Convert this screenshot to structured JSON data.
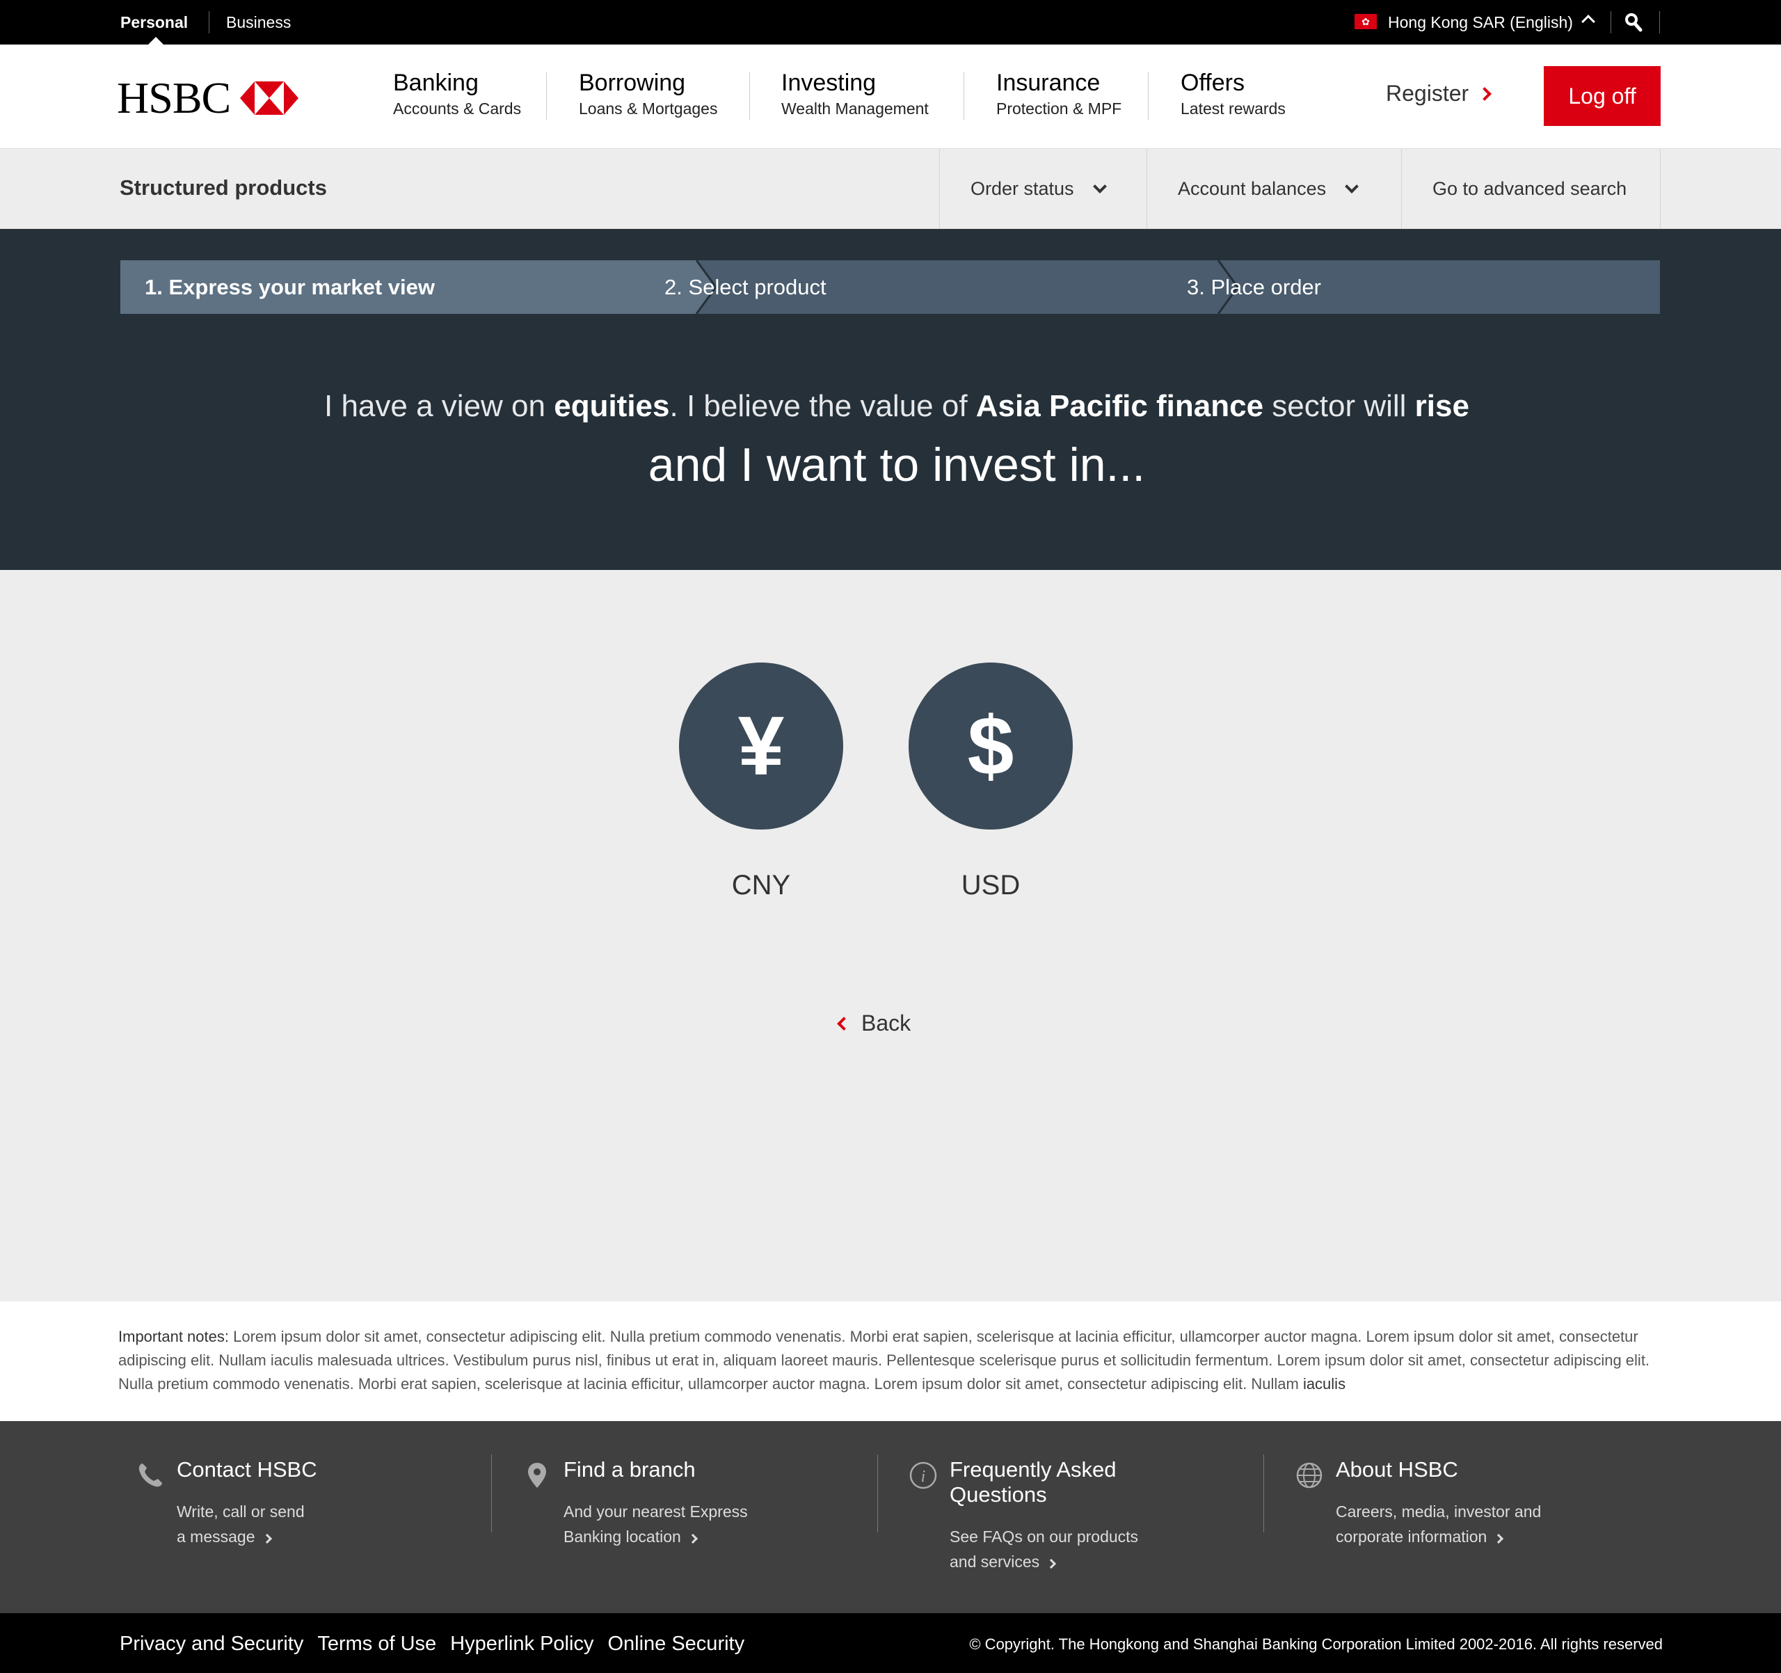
{
  "topbar": {
    "personal": "Personal",
    "business": "Business",
    "region": "Hong Kong SAR (English)"
  },
  "header": {
    "logo": "HSBC",
    "nav": [
      {
        "title": "Banking",
        "sub": "Accounts & Cards"
      },
      {
        "title": "Borrowing",
        "sub": "Loans & Mortgages"
      },
      {
        "title": "Investing",
        "sub": "Wealth Management"
      },
      {
        "title": "Insurance",
        "sub": "Protection & MPF"
      },
      {
        "title": "Offers",
        "sub": "Latest rewards"
      }
    ],
    "register": "Register",
    "logoff": "Log off"
  },
  "subnav": {
    "title": "Structured products",
    "order_status": "Order status",
    "account_balances": "Account balances",
    "advanced_search": "Go to advanced search"
  },
  "steps": [
    {
      "label": "1. Express your market view",
      "active": true
    },
    {
      "label": "2. Select product",
      "active": false
    },
    {
      "label": "3. Place order",
      "active": false
    }
  ],
  "hero": {
    "p1": "I have a view on ",
    "asset": "equities",
    "p2": ". I believe the value of ",
    "sector": "Asia Pacific finance",
    "p3": " sector will ",
    "direction": "rise",
    "line2": "and I want to invest in..."
  },
  "currencies": [
    {
      "symbol": "¥",
      "code": "CNY"
    },
    {
      "symbol": "$",
      "code": "USD"
    }
  ],
  "back": "Back",
  "notes": {
    "label": "Important notes:",
    "text": " Lorem ipsum dolor sit amet, consectetur adipiscing elit. Nulla pretium commodo venenatis. Morbi erat sapien, scelerisque at lacinia efficitur, ullamcorper auctor magna. Lorem ipsum dolor sit amet, consectetur adipiscing elit. Nullam iaculis malesuada ultrices. Vestibulum purus nisl, finibus ut erat in, aliquam laoreet mauris. Pellentesque scelerisque purus et sollicitudin fermentum. Lorem ipsum dolor sit amet, consectetur adipiscing elit. Nulla pretium commodo venenatis. Morbi erat sapien, scelerisque at lacinia efficitur, ullamcorper auctor magna. Lorem ipsum dolor sit amet, consectetur adipiscing elit. Nullam ",
    "tail": "iaculis"
  },
  "footer": {
    "cols": [
      {
        "title": "Contact HSBC",
        "l1": "Write, call or send",
        "l2": "a message"
      },
      {
        "title": "Find a branch",
        "l1": "And your nearest Express",
        "l2": "Banking location"
      },
      {
        "title": "Frequently Asked Questions",
        "l1": "See FAQs on our products",
        "l2": "and services"
      },
      {
        "title": "About HSBC",
        "l1": "Careers, media, investor and",
        "l2": "corporate information"
      }
    ],
    "links": [
      "Privacy and Security",
      "Terms of Use",
      "Hyperlink Policy",
      "Online Security"
    ],
    "copyright": "© Copyright. The Hongkong and Shanghai Banking Corporation Limited 2002-2016. All rights reserved"
  },
  "colors": {
    "brand_red": "#db0011",
    "hero_bg": "#253039",
    "step_active": "#5f7284",
    "step_inactive": "#4a5c6d",
    "coin_bg": "#3b4a58"
  },
  "icons": [
    "search-icon",
    "chevron-up-icon",
    "chevron-down-icon",
    "chevron-right-icon",
    "chevron-left-icon",
    "phone-icon",
    "location-pin-icon",
    "info-icon",
    "globe-icon",
    "yen-icon",
    "dollar-icon"
  ]
}
